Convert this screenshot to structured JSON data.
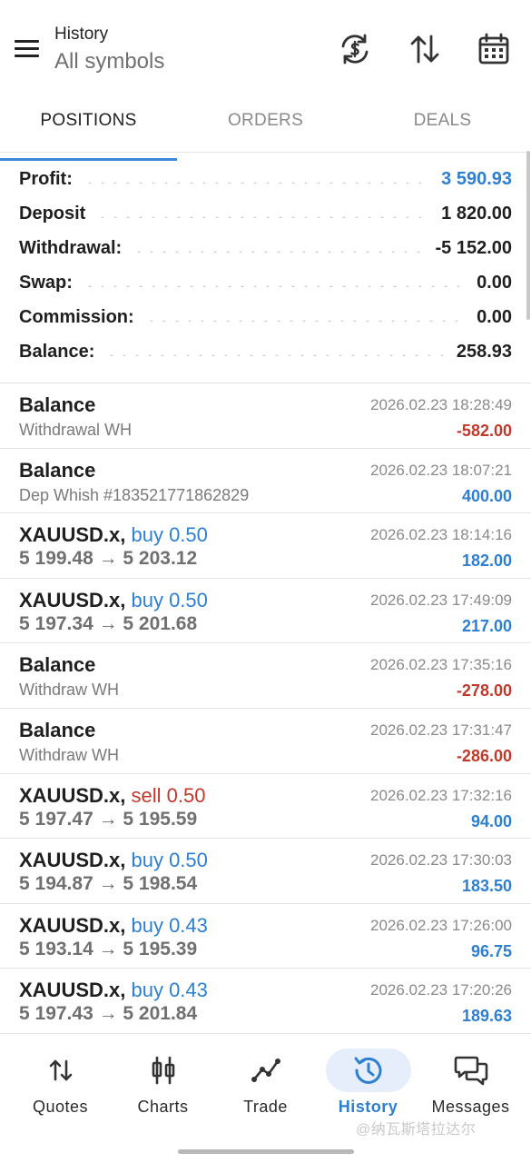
{
  "header": {
    "title": "History",
    "subtitle": "All symbols",
    "icons": [
      "sync-currency-icon",
      "sort-arrows-icon",
      "calendar-icon"
    ]
  },
  "tabs": [
    {
      "label": "POSITIONS",
      "active": true
    },
    {
      "label": "ORDERS",
      "active": false
    },
    {
      "label": "DEALS",
      "active": false
    }
  ],
  "summary": [
    {
      "label": "Profit:",
      "value": "3 590.93",
      "accent": "#2d7fd1"
    },
    {
      "label": "Deposit",
      "value": "1 820.00"
    },
    {
      "label": "Withdrawal:",
      "value": "-5 152.00"
    },
    {
      "label": "Swap:",
      "value": "0.00"
    },
    {
      "label": "Commission:",
      "value": "0.00"
    },
    {
      "label": "Balance:",
      "value": "258.93"
    }
  ],
  "rows": [
    {
      "kind": "balance",
      "title": "Balance",
      "comment": "Withdrawal WH",
      "time": "2026.02.23 18:28:49",
      "amount": "-582.00",
      "sign": "neg"
    },
    {
      "kind": "balance",
      "title": "Balance",
      "comment": "Dep Whish #183521771862829",
      "time": "2026.02.23 18:07:21",
      "amount": "400.00",
      "sign": "pos"
    },
    {
      "kind": "trade",
      "symbol": "XAUUSD.x,",
      "side": "buy 0.50",
      "side_type": "buy",
      "prices": "5 199.48 → 5 203.12",
      "time": "2026.02.23 18:14:16",
      "amount": "182.00",
      "sign": "pos"
    },
    {
      "kind": "trade",
      "symbol": "XAUUSD.x,",
      "side": "buy 0.50",
      "side_type": "buy",
      "prices": "5 197.34 → 5 201.68",
      "time": "2026.02.23 17:49:09",
      "amount": "217.00",
      "sign": "pos"
    },
    {
      "kind": "balance",
      "title": "Balance",
      "comment": "Withdraw WH",
      "time": "2026.02.23 17:35:16",
      "amount": "-278.00",
      "sign": "neg"
    },
    {
      "kind": "balance",
      "title": "Balance",
      "comment": "Withdraw WH",
      "time": "2026.02.23 17:31:47",
      "amount": "-286.00",
      "sign": "neg"
    },
    {
      "kind": "trade",
      "symbol": "XAUUSD.x,",
      "side": "sell 0.50",
      "side_type": "sell",
      "prices": "5 197.47 → 5 195.59",
      "time": "2026.02.23 17:32:16",
      "amount": "94.00",
      "sign": "pos"
    },
    {
      "kind": "trade",
      "symbol": "XAUUSD.x,",
      "side": "buy 0.50",
      "side_type": "buy",
      "prices": "5 194.87 → 5 198.54",
      "time": "2026.02.23 17:30:03",
      "amount": "183.50",
      "sign": "pos"
    },
    {
      "kind": "trade",
      "symbol": "XAUUSD.x,",
      "side": "buy 0.43",
      "side_type": "buy",
      "prices": "5 193.14 → 5 195.39",
      "time": "2026.02.23 17:26:00",
      "amount": "96.75",
      "sign": "pos"
    },
    {
      "kind": "trade",
      "symbol": "XAUUSD.x,",
      "side": "buy 0.43",
      "side_type": "buy",
      "prices": "5 197.43 → 5 201.84",
      "time": "2026.02.23 17:20:26",
      "amount": "189.63",
      "sign": "pos"
    }
  ],
  "bottom_nav": [
    {
      "label": "Quotes",
      "icon": "quotes-arrows-icon",
      "active": false
    },
    {
      "label": "Charts",
      "icon": "candlestick-icon",
      "active": false
    },
    {
      "label": "Trade",
      "icon": "trade-line-icon",
      "active": false
    },
    {
      "label": "History",
      "icon": "history-clock-icon",
      "active": true
    },
    {
      "label": "Messages",
      "icon": "messages-icon",
      "active": false
    }
  ],
  "watermark": "@纳瓦斯塔拉达尔",
  "colors": {
    "accent_blue": "#2d7fd1",
    "loss_red": "#c0392b",
    "active_pill": "#e6eefb"
  }
}
